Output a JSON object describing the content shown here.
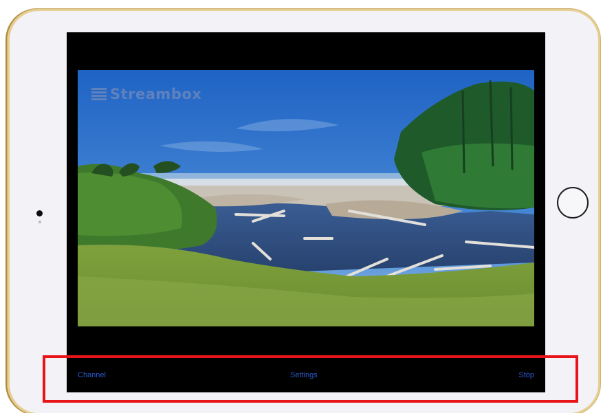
{
  "device": {
    "camera_icon": "front-camera-icon",
    "home_button_icon": "home-button-icon"
  },
  "video": {
    "watermark_text": "Streambox",
    "scene": "coastal-river-landscape"
  },
  "toolbar": {
    "channel_label": "Channel",
    "settings_label": "Settings",
    "stop_label": "Stop"
  },
  "colors": {
    "toolbar_text": "#2a58c9",
    "screen_bg": "#000000",
    "bezel": "#f3f2f6",
    "frame_gold": "#e7cf93",
    "highlight": "#e8141a"
  }
}
